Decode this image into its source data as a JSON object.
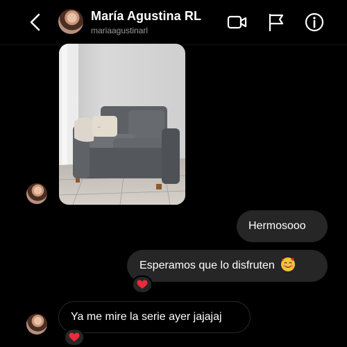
{
  "header": {
    "name": "María Agustina RL",
    "username": "mariaagustinarl"
  },
  "icons": {
    "back": "chevron-left-icon",
    "video": "video-camera-icon",
    "flag": "flag-icon",
    "info": "info-icon",
    "reaction": "heart-icon",
    "emoji": "smiling-face-with-hearts-icon"
  },
  "messages": [
    {
      "type": "image",
      "sender": "them",
      "description": "gray sofa with pillows in a white room"
    },
    {
      "type": "text",
      "sender": "me",
      "text": "Hermosooo"
    },
    {
      "type": "text",
      "sender": "me",
      "text": "Esperamos que lo disfruten",
      "reaction": "heart"
    },
    {
      "type": "text",
      "sender": "them",
      "text": "Ya me mire la serie ayer jajajaj",
      "reaction": "heart"
    }
  ],
  "colors": {
    "background": "#000000",
    "bubble": "#262626",
    "secondary_text": "#9b9b9b",
    "heart": "#ed2a3a"
  }
}
